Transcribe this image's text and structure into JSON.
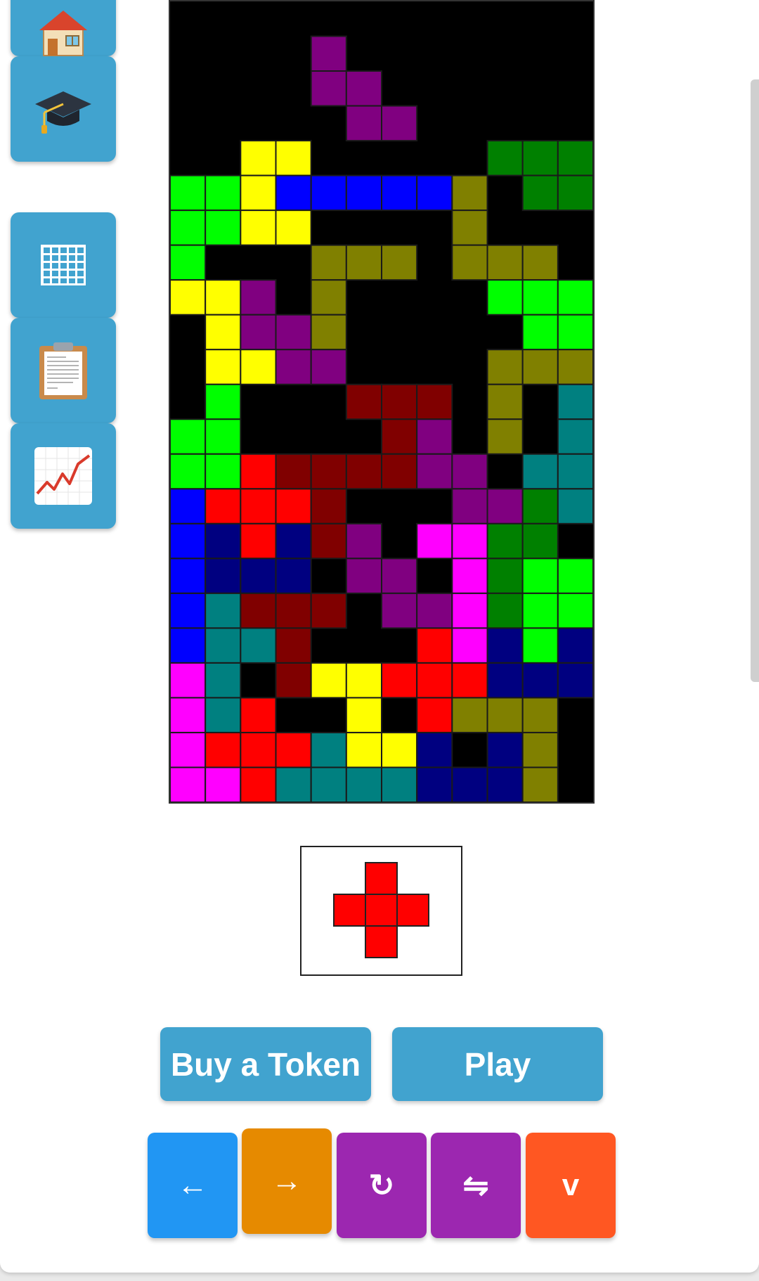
{
  "sidebar": {
    "items": [
      {
        "name": "home",
        "icon": "house-icon"
      },
      {
        "name": "learn",
        "icon": "graduation-cap-icon"
      },
      {
        "name": "grid",
        "icon": "grid-icon"
      },
      {
        "name": "clipboard",
        "icon": "clipboard-icon"
      },
      {
        "name": "stats",
        "icon": "chart-increasing-icon"
      }
    ]
  },
  "colors": {
    "P": "#800080",
    "Y": "#ffff00",
    "G": "#008000",
    "L": "#00ff00",
    "B": "#0000ff",
    "O": "#808000",
    "M": "#800000",
    "T": "#008080",
    "R": "#ff0000",
    "N": "#000080",
    "F": "#ff00ff",
    "button_blue": "#41a3cf",
    "left_btn": "#2196f3",
    "right_btn": "#e68a00",
    "rotate_btn": "#9c27b0",
    "flip_btn": "#9c27b0",
    "drop_btn": "#ff5722"
  },
  "board": {
    "cols": 12,
    "rows": 23,
    "grid": [
      "............",
      "....P.......",
      "....PP......",
      ".....PP.....",
      "..YY.....GGG",
      "LLYBBBBBO.GG",
      "LLYY....O...",
      "L...OOO.OOO.",
      "YYP.O....LLL",
      ".YPPO.....LL",
      ".YYPP....OOO",
      ".L...MMM.O.T",
      "LL....MP.O.T",
      "LLRMMMMPP.TT",
      "BRRRM...PPGT",
      "BNRNMP.FFGG.",
      "BNNN.PP.FGLL",
      "BTMMM.PPFGLL",
      "BTTM...RFNLN",
      "FT.MYYRRRNNN",
      "FTR..Y.ROOO.",
      "FRRRTYYN.NO.",
      "FFRTTTTNNNO."
    ]
  },
  "next_piece": {
    "name": "plus",
    "color": "R",
    "cells": [
      [
        1,
        0
      ],
      [
        0,
        1
      ],
      [
        1,
        1
      ],
      [
        2,
        1
      ],
      [
        1,
        2
      ]
    ]
  },
  "actions": {
    "buy_token": "Buy a Token",
    "play": "Play"
  },
  "controls": {
    "left": "←",
    "right": "→",
    "rotate": "↻",
    "flip": "⇋",
    "drop": "v"
  }
}
